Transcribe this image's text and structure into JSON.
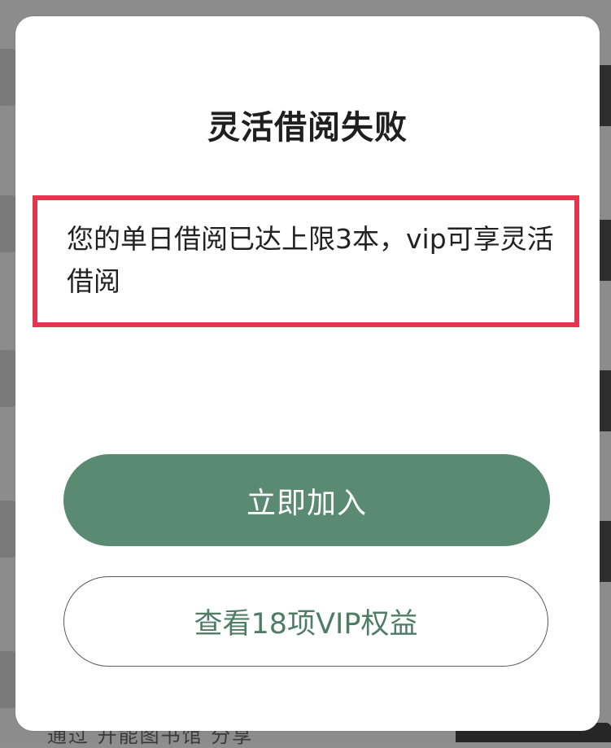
{
  "dialog": {
    "title": "灵活借阅失败",
    "message": "您的单日借阅已达上限3本，vip可享灵活借阅",
    "primary_button_label": "立即加入",
    "secondary_button_label": "查看18项VIP权益"
  },
  "background": {
    "partial_text": "通过 开能图书馆 分享"
  },
  "colors": {
    "primary_button": "#5a8a72",
    "secondary_button_text": "#4f7c66",
    "highlight_border": "#e2364e",
    "overlay": "#8c8c8c"
  }
}
